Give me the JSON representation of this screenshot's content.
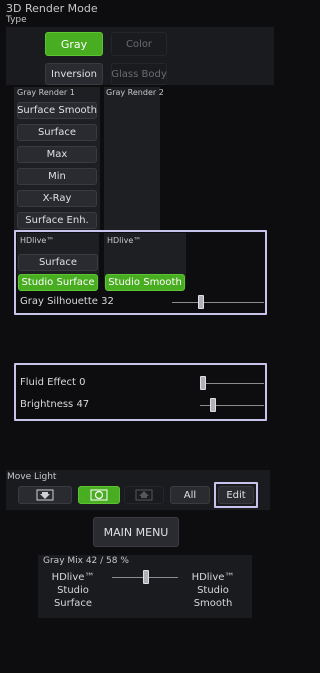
{
  "header": {
    "title": "3D Render Mode",
    "type_label": "Type"
  },
  "type_buttons": {
    "gray": "Gray",
    "color": "Color",
    "inversion": "Inversion",
    "glass_body": "Glass Body"
  },
  "gray_render_1": {
    "header": "Gray Render 1",
    "items": [
      "Surface Smooth",
      "Surface",
      "Max",
      "Min",
      "X-Ray",
      "Surface Enh."
    ]
  },
  "gray_render_2": {
    "header": "Gray Render 2"
  },
  "hdlive": {
    "col1_header": "HDlive™",
    "col2_header": "HDlive™",
    "surface": "Surface",
    "studio_surface": "Studio Surface",
    "studio_smooth": "Studio Smooth",
    "silhouette_label": "Gray Silhouette 32",
    "silhouette_value": 32
  },
  "fluid": {
    "fluid_effect_label": "Fluid Effect 0",
    "fluid_effect_value": 0,
    "brightness_label": "Brightness 47",
    "brightness_value": 47
  },
  "move_light": {
    "label": "Move Light",
    "all": "All",
    "edit": "Edit"
  },
  "main_menu": "MAIN MENU",
  "gray_mix": {
    "label": "Gray Mix 42 / 58 %",
    "value": 42,
    "left_line1": "HDlive™",
    "left_line2": "Studio",
    "left_line3": "Surface",
    "right_line1": "HDlive™",
    "right_line2": "Studio",
    "right_line3": "Smooth"
  },
  "colors": {
    "accent_green": "#49ad21",
    "highlight_border": "#c7c4ec"
  }
}
